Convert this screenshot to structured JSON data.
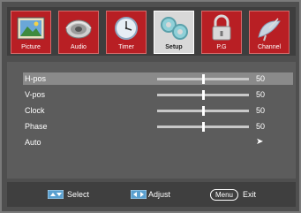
{
  "tabs": [
    {
      "label": "Picture",
      "icon": "picture-icon",
      "active": false
    },
    {
      "label": "Audio",
      "icon": "speaker-icon",
      "active": false
    },
    {
      "label": "Timer",
      "icon": "clock-icon",
      "active": false
    },
    {
      "label": "Setup",
      "icon": "gears-icon",
      "active": true
    },
    {
      "label": "P.G",
      "icon": "lock-icon",
      "active": false
    },
    {
      "label": "Channel",
      "icon": "satellite-dish-icon",
      "active": false
    }
  ],
  "menu": {
    "items": [
      {
        "label": "H-pos",
        "value": "50",
        "level": 0.5,
        "selected": true
      },
      {
        "label": "V-pos",
        "value": "50",
        "level": 0.5,
        "selected": false
      },
      {
        "label": "Clock",
        "value": "50",
        "level": 0.5,
        "selected": false
      },
      {
        "label": "Phase",
        "value": "50",
        "level": 0.5,
        "selected": false
      },
      {
        "label": "Auto",
        "value": "➤",
        "selected": false
      }
    ]
  },
  "footer": {
    "select_label": "Select",
    "adjust_label": "Adjust",
    "menu_key": "Menu",
    "exit_label": "Exit"
  },
  "colors": {
    "tab_red": "#b81f24",
    "tab_active": "#d8d8d8",
    "panel": "#5c5c5c",
    "highlight": "#8a8a8a"
  }
}
